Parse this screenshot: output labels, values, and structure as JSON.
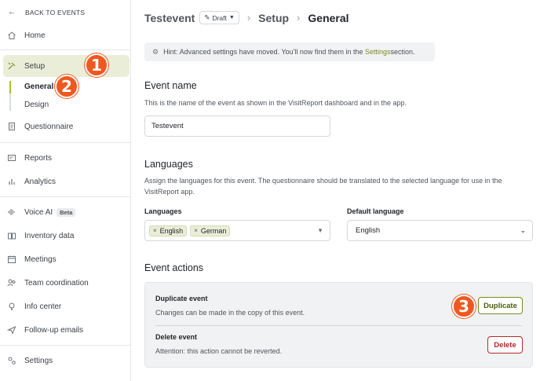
{
  "sidebar": {
    "back_label": "BACK TO EVENTS",
    "items": [
      {
        "label": "Home",
        "icon": "home-icon"
      },
      {
        "label": "Setup",
        "icon": "tools-icon"
      },
      {
        "label": "Questionnaire",
        "icon": "document-icon"
      },
      {
        "label": "Reports",
        "icon": "report-icon"
      },
      {
        "label": "Analytics",
        "icon": "bar-chart-icon"
      },
      {
        "label": "Voice AI",
        "icon": "soundwave-icon",
        "badge": "Beta"
      },
      {
        "label": "Inventory data",
        "icon": "book-icon"
      },
      {
        "label": "Meetings",
        "icon": "calendar-icon"
      },
      {
        "label": "Team coordination",
        "icon": "team-icon"
      },
      {
        "label": "Info center",
        "icon": "lightbulb-icon"
      },
      {
        "label": "Follow-up emails",
        "icon": "send-icon"
      },
      {
        "label": "Settings",
        "icon": "settings-icon"
      }
    ],
    "sub_items": [
      {
        "label": "General"
      },
      {
        "label": "Design"
      }
    ]
  },
  "markers": [
    "1",
    "2",
    "3"
  ],
  "header": {
    "event_name": "Testevent",
    "status": "Draft",
    "crumb_setup": "Setup",
    "crumb_current": "General"
  },
  "hint": {
    "text_before": "Hint: Advanced settings have moved. You'll now find them in the ",
    "link": "Settings",
    "text_after": " section."
  },
  "event_name": {
    "heading": "Event name",
    "description": "This is the name of the event as shown in the VisitReport dashboard and in the app.",
    "value": "Testevent"
  },
  "languages": {
    "heading": "Languages",
    "description": "Assign the languages for this event. The questionnaire should be translated to the selected language for use in the VisitReport app.",
    "field_label": "Languages",
    "selected": [
      "English",
      "German"
    ],
    "default_label": "Default language",
    "default_value": "English"
  },
  "event_actions": {
    "heading": "Event actions",
    "duplicate": {
      "title": "Duplicate event",
      "description": "Changes can be made in the copy of this event.",
      "button": "Duplicate"
    },
    "delete": {
      "title": "Delete event",
      "description": "Attention: this action cannot be reverted.",
      "button": "Delete"
    }
  },
  "colors": {
    "accent": "#7b8a1e",
    "active_bg": "#eaeed8",
    "danger": "#b02a2a",
    "marker": "#f0581f"
  }
}
